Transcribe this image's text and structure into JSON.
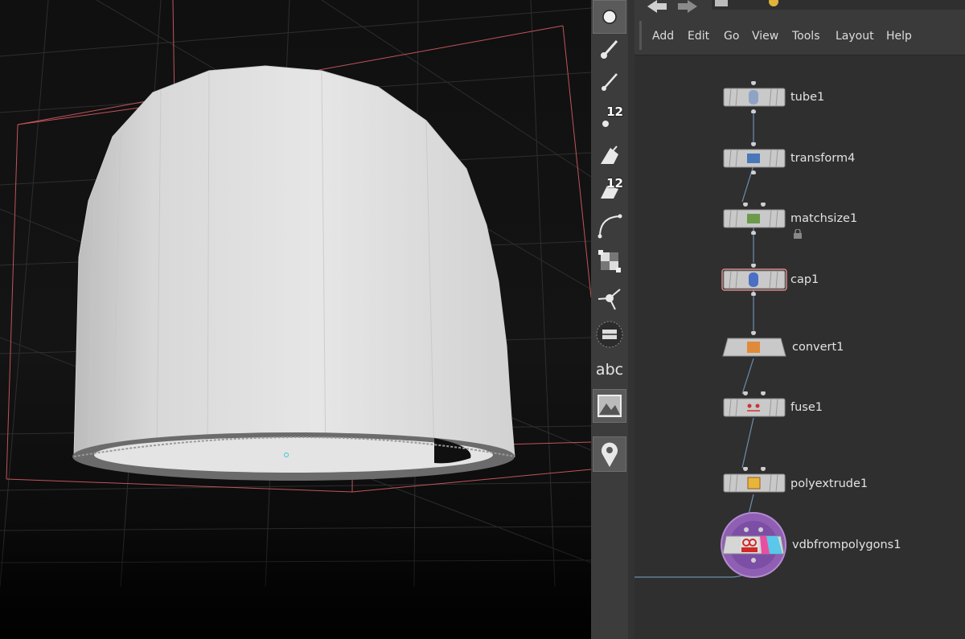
{
  "menu": {
    "items": [
      {
        "label": "Add"
      },
      {
        "label": "Edit"
      },
      {
        "label": "Go"
      },
      {
        "label": "View"
      },
      {
        "label": "Tools"
      },
      {
        "label": "Layout"
      },
      {
        "label": "Help"
      }
    ]
  },
  "shelf": {
    "tools": [
      {
        "icon": "select-icon",
        "selected": true
      },
      {
        "icon": "brush-icon"
      },
      {
        "icon": "pen-icon"
      },
      {
        "icon": "point-count-icon",
        "badge": "12"
      },
      {
        "icon": "handle-icon"
      },
      {
        "icon": "face-count-icon",
        "badge": "12"
      },
      {
        "icon": "curve-icon"
      },
      {
        "icon": "snap-grid-icon"
      },
      {
        "icon": "transform-gizmo-icon"
      },
      {
        "icon": "record-icon"
      },
      {
        "icon": "text-icon",
        "text": "abc"
      },
      {
        "icon": "background-image-icon"
      },
      {
        "icon": "location-pin-icon"
      }
    ]
  },
  "nodes": [
    {
      "name": "tube1",
      "icon": "tube-icon"
    },
    {
      "name": "transform4",
      "icon": "transform-icon"
    },
    {
      "name": "matchsize1",
      "icon": "matchsize-icon",
      "locked": true
    },
    {
      "name": "cap1",
      "icon": "cap-icon",
      "selected": true
    },
    {
      "name": "convert1",
      "icon": "convert-icon"
    },
    {
      "name": "fuse1",
      "icon": "fuse-icon"
    },
    {
      "name": "polyextrude1",
      "icon": "polyextrude-icon"
    },
    {
      "name": "vdbfrompolygons1",
      "icon": "vdb-icon",
      "display": true
    }
  ],
  "colors": {
    "selection_outline": "#d98a8a",
    "bbox": "#c2545c",
    "wire": "#6d8fb0",
    "display_flag": "#8f5fb3"
  }
}
